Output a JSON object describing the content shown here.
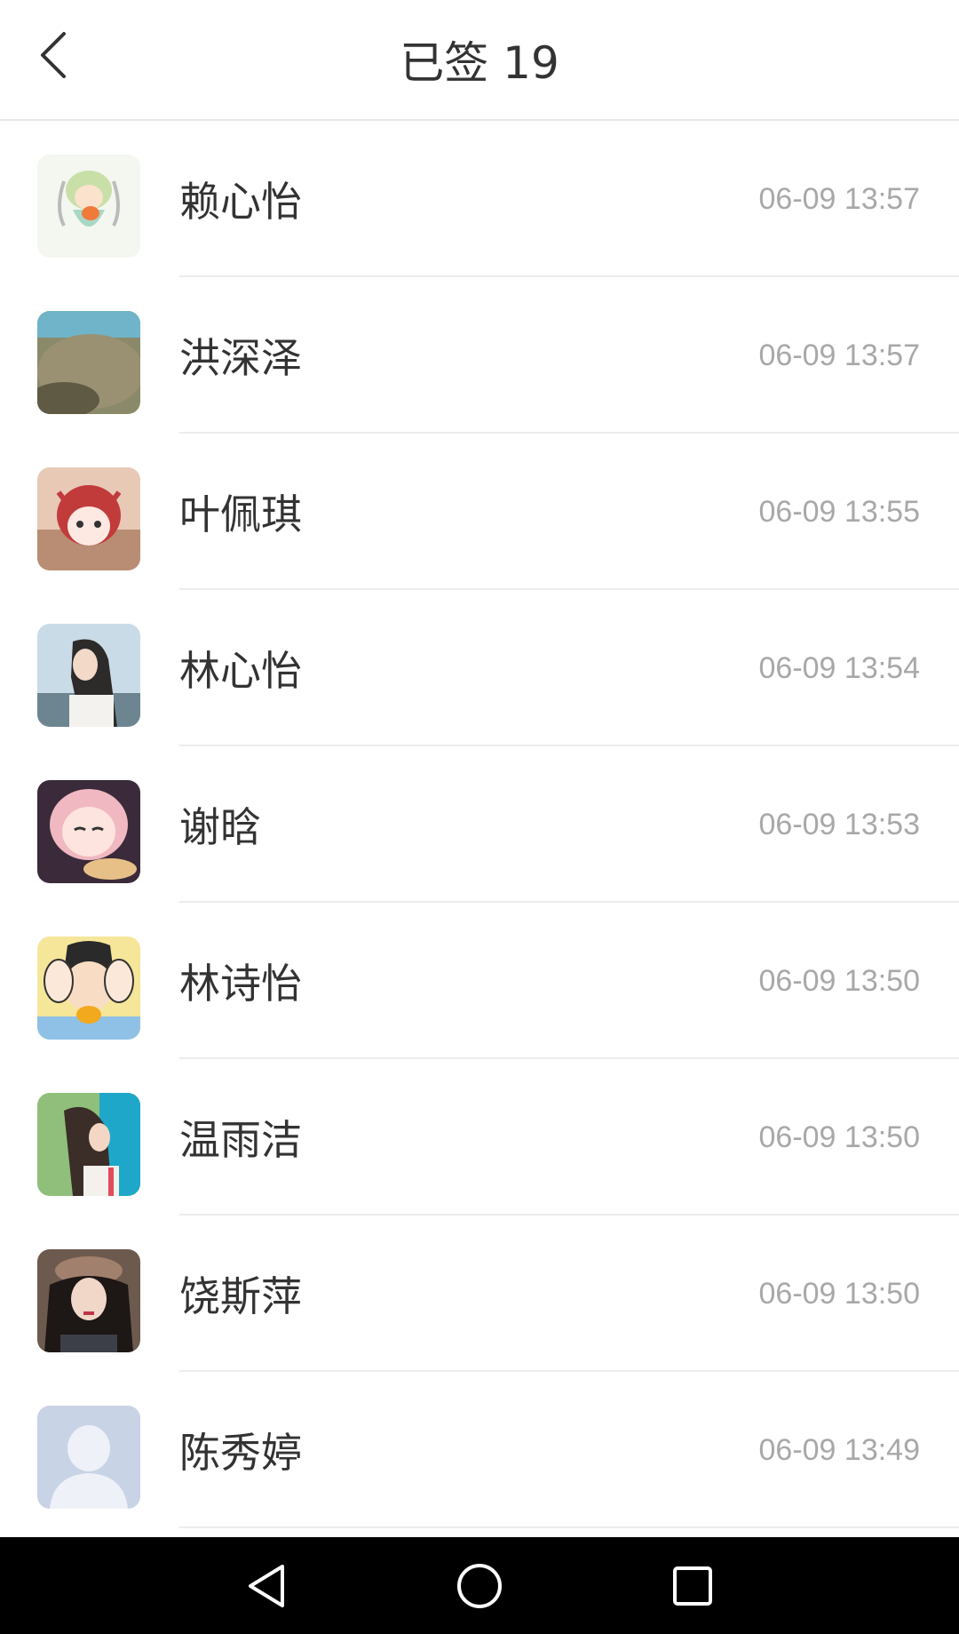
{
  "header": {
    "title": "已签 19",
    "back_icon": "chevron-left-icon"
  },
  "contacts": [
    {
      "name": "赖心怡",
      "time": "06-09 13:57"
    },
    {
      "name": "洪深泽",
      "time": "06-09 13:57"
    },
    {
      "name": "叶佩琪",
      "time": "06-09 13:55"
    },
    {
      "name": "林心怡",
      "time": "06-09 13:54"
    },
    {
      "name": "谢晗",
      "time": "06-09 13:53"
    },
    {
      "name": "林诗怡",
      "time": "06-09 13:50"
    },
    {
      "name": "温雨洁",
      "time": "06-09 13:50"
    },
    {
      "name": "饶斯萍",
      "time": "06-09 13:50"
    },
    {
      "name": "陈秀婷",
      "time": "06-09 13:49"
    }
  ],
  "navbar": {
    "back": "triangle-back-icon",
    "home": "circle-home-icon",
    "recents": "square-recents-icon"
  }
}
